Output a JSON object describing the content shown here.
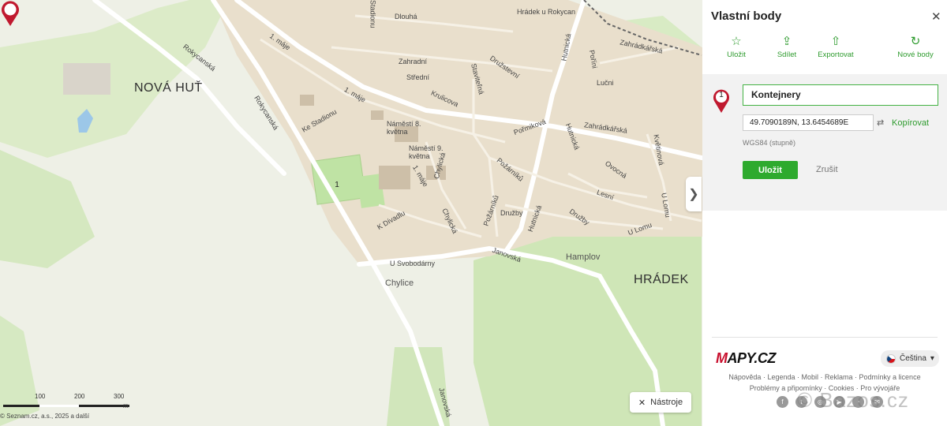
{
  "map": {
    "streets": [
      "Rokycanská",
      "Rokycanská",
      "Ke Stadionu",
      "1. máje",
      "1. máje",
      "1. máje",
      "Ke Stadionu",
      "Dlouhá",
      "Zahradní",
      "Střední",
      "Krulicova",
      "Družstevní",
      "Staviteľná",
      "Hutnická",
      "Hutnická",
      "Hutnická",
      "Zahrádkářská",
      "Zahrádkářská",
      "Pořmiková",
      "Lučni",
      "Poříni",
      "Požárníků",
      "Požárníků",
      "Družby",
      "Družby",
      "Lesní",
      "Ovocná",
      "Květinová",
      "U Lomu",
      "U Lomu",
      "K Dívadlu",
      "Chylická",
      "Chylická",
      "U Svobodárny",
      "Janovská",
      "Janovská",
      "Čmárecká"
    ],
    "places": {
      "nova_hut": "NOVÁ HUŤ",
      "hradek": "HRÁDEK",
      "hradek_u_rokycan": "Hrádek u Rokycan",
      "hamplov": "Hamplov",
      "chylice": "Chylice",
      "namesti_8": "Náměstí 8. května",
      "namesti_9": "Náměstí 9. května"
    },
    "pin_number": "1",
    "scale_labels": [
      "100",
      "200",
      "300",
      "m"
    ],
    "copyright": "© Seznam.cz, a.s., 2025 a další",
    "tools_label": "Nástroje",
    "collapse_icon": "chevron-right"
  },
  "panel": {
    "title": "Vlastní body",
    "toolbar": [
      {
        "label": "Uložit",
        "icon": "star-icon"
      },
      {
        "label": "Sdílet",
        "icon": "share-icon"
      },
      {
        "label": "Exportovat",
        "icon": "export-icon"
      },
      {
        "label": "Nové body",
        "icon": "refresh-icon"
      }
    ],
    "point": {
      "number": "1",
      "name": "Kontejnery",
      "coords": "49.7090189N, 13.6454689E",
      "copy_label": "Kopírovat",
      "system": "WGS84 (stupně)",
      "save_label": "Uložit",
      "cancel_label": "Zrušit"
    },
    "footer": {
      "logo": "MAPY.CZ",
      "language": "Čeština",
      "links_row1": [
        "Nápověda",
        "Legenda",
        "Mobil",
        "Reklama",
        "Podmínky a licence"
      ],
      "links_row2": [
        "Problémy a připomínky",
        "Cookies",
        "Pro vývojáře"
      ]
    },
    "watermark": "© Bazos.cz"
  },
  "colors": {
    "accent": "#2eaa2e",
    "pin": "#c0192f",
    "map_base": "#eef0e6",
    "forest": "#cfe8b8",
    "urban": "#e9dfcc"
  }
}
